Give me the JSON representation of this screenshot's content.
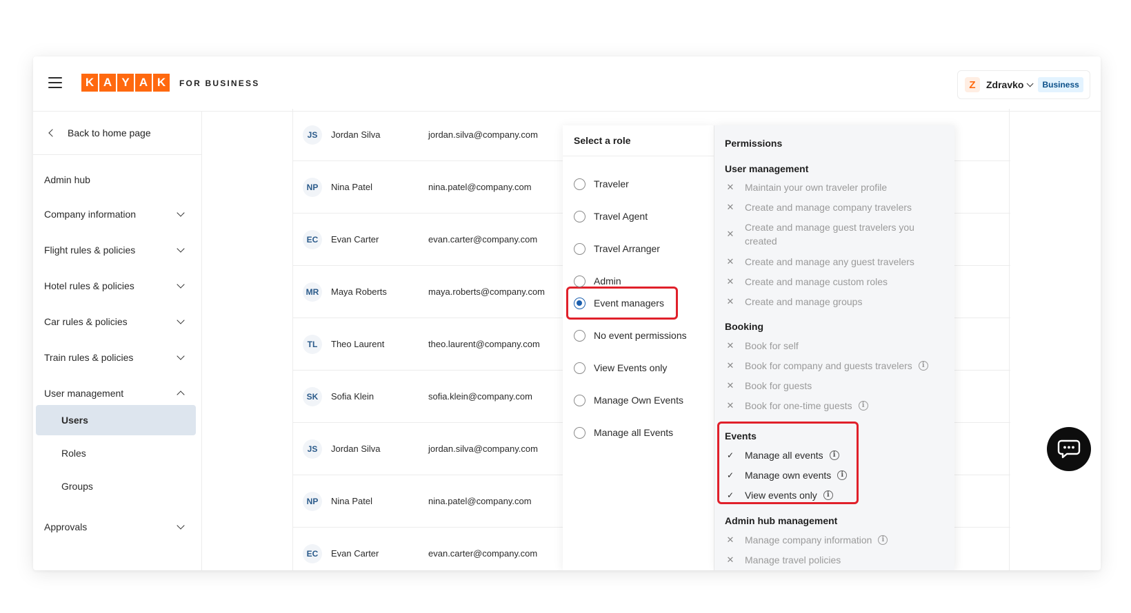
{
  "header": {
    "logo_letters": [
      "K",
      "A",
      "Y",
      "A",
      "K"
    ],
    "brand_suffix": "FOR BUSINESS",
    "user_initial": "Z",
    "user_name": "Zdravko",
    "account_badge": "Business",
    "brand_color": "#ff690f"
  },
  "sidebar": {
    "back_label": "Back to home page",
    "admin_hub": "Admin hub",
    "sections": [
      {
        "label": "Company information",
        "expanded": false
      },
      {
        "label": "Flight rules & policies",
        "expanded": false
      },
      {
        "label": "Hotel rules & policies",
        "expanded": false
      },
      {
        "label": "Car rules & policies",
        "expanded": false
      },
      {
        "label": "Train rules & policies",
        "expanded": false
      },
      {
        "label": "User management",
        "expanded": true
      }
    ],
    "sub_items": [
      {
        "label": "Users",
        "active": true
      },
      {
        "label": "Roles",
        "active": false
      },
      {
        "label": "Groups",
        "active": false
      }
    ],
    "approvals": "Approvals"
  },
  "users": [
    {
      "initials": "JS",
      "name": "Jordan Silva",
      "email": "jordan.silva@company.com"
    },
    {
      "initials": "NP",
      "name": "Nina Patel",
      "email": "nina.patel@company.com"
    },
    {
      "initials": "EC",
      "name": "Evan Carter",
      "email": "evan.carter@company.com"
    },
    {
      "initials": "MR",
      "name": "Maya Roberts",
      "email": "maya.roberts@company.com"
    },
    {
      "initials": "TL",
      "name": "Theo Laurent",
      "email": "theo.laurent@company.com"
    },
    {
      "initials": "SK",
      "name": "Sofia Klein",
      "email": "sofia.klein@company.com"
    },
    {
      "initials": "JS",
      "name": "Jordan Silva",
      "email": "jordan.silva@company.com"
    },
    {
      "initials": "NP",
      "name": "Nina Patel",
      "email": "nina.patel@company.com"
    },
    {
      "initials": "EC",
      "name": "Evan Carter",
      "email": "evan.carter@company.com"
    }
  ],
  "roles": {
    "title": "Select a role",
    "options": [
      {
        "label": "Traveler",
        "selected": false
      },
      {
        "label": "Travel Agent",
        "selected": false
      },
      {
        "label": "Travel Arranger",
        "selected": false
      },
      {
        "label": "Admin",
        "selected": false
      },
      {
        "label": "Event managers",
        "selected": true
      },
      {
        "label": "No event permissions",
        "selected": false
      },
      {
        "label": "View Events only",
        "selected": false
      },
      {
        "label": "Manage Own Events",
        "selected": false
      },
      {
        "label": "Manage all Events",
        "selected": false
      }
    ]
  },
  "permissions": {
    "title": "Permissions",
    "groups": [
      {
        "title": "User management",
        "items": [
          {
            "label": "Maintain your own traveler profile",
            "granted": false,
            "info": false
          },
          {
            "label": "Create and manage company travelers",
            "granted": false,
            "info": false
          },
          {
            "label": "Create and manage guest travelers you created",
            "granted": false,
            "info": false
          },
          {
            "label": "Create and manage any guest travelers",
            "granted": false,
            "info": false
          },
          {
            "label": "Create and manage custom roles",
            "granted": false,
            "info": false
          },
          {
            "label": "Create and manage groups",
            "granted": false,
            "info": false
          }
        ]
      },
      {
        "title": "Booking",
        "items": [
          {
            "label": "Book for self",
            "granted": false,
            "info": false
          },
          {
            "label": "Book for company and guests travelers",
            "granted": false,
            "info": true
          },
          {
            "label": "Book for guests",
            "granted": false,
            "info": false
          },
          {
            "label": "Book for one-time guests",
            "granted": false,
            "info": true
          }
        ]
      },
      {
        "title": "Events",
        "items": [
          {
            "label": "Manage all events",
            "granted": true,
            "info": true
          },
          {
            "label": "Manage own events",
            "granted": true,
            "info": true
          },
          {
            "label": "View events only",
            "granted": true,
            "info": true
          }
        ]
      },
      {
        "title": "Admin hub management",
        "items": [
          {
            "label": "Manage company information",
            "granted": false,
            "info": true
          },
          {
            "label": "Manage travel policies",
            "granted": false,
            "info": false
          }
        ]
      }
    ]
  },
  "highlight_color": "#e0202a",
  "icons": {
    "granted": "✓",
    "denied": "✕",
    "info": "i"
  }
}
